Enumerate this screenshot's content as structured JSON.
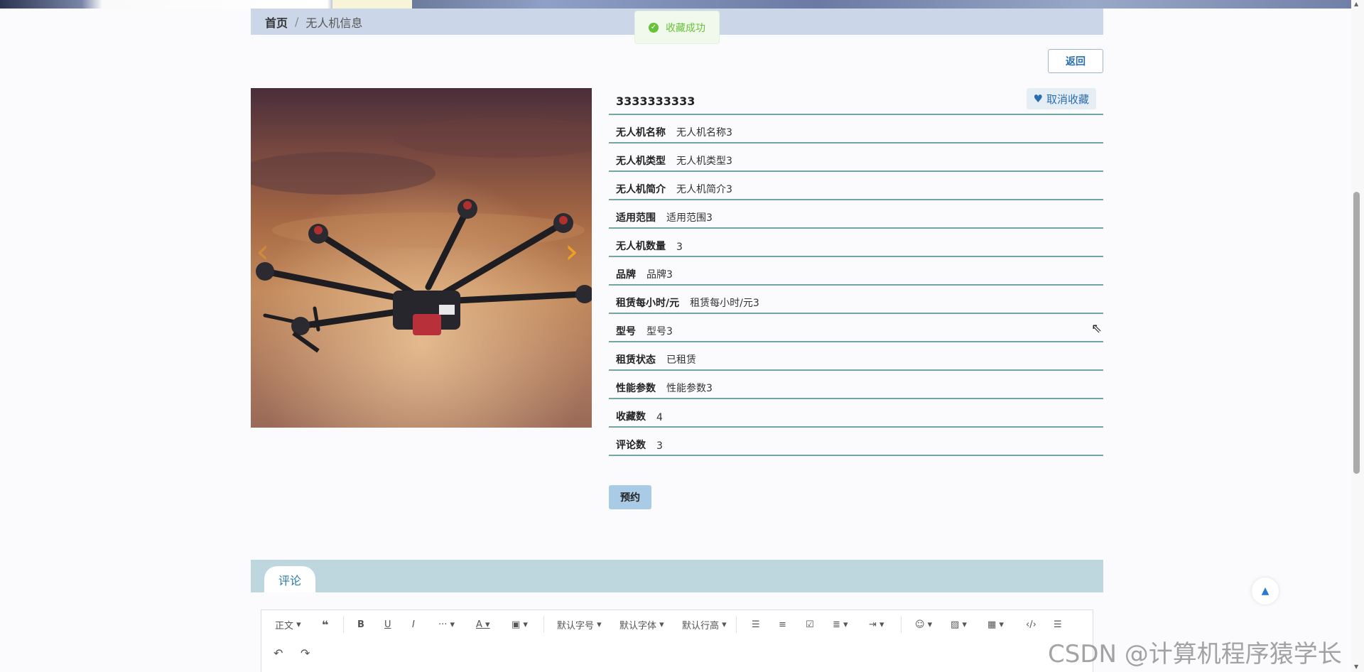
{
  "breadcrumb": {
    "home": "首页",
    "separator": "/",
    "current": "无人机信息"
  },
  "toast": {
    "message": "收藏成功",
    "icon": "check-circle-icon",
    "color": "#67c23a"
  },
  "back_button": "返回",
  "carousel": {
    "image": "hexacopter-drone-sunset-sky",
    "prev_icon": "chevron-left-icon",
    "next_icon": "chevron-right-icon"
  },
  "detail": {
    "title": "3333333333",
    "favorite_button": {
      "label": "取消收藏",
      "icon": "heart-icon"
    },
    "fields": [
      {
        "label": "无人机名称",
        "value": "无人机名称3"
      },
      {
        "label": "无人机类型",
        "value": "无人机类型3"
      },
      {
        "label": "无人机简介",
        "value": "无人机简介3"
      },
      {
        "label": "适用范围",
        "value": "适用范围3"
      },
      {
        "label": "无人机数量",
        "value": "3"
      },
      {
        "label": "品牌",
        "value": "品牌3"
      },
      {
        "label": "租赁每小时/元",
        "value": "租赁每小时/元3"
      },
      {
        "label": "型号",
        "value": "型号3"
      },
      {
        "label": "租赁状态",
        "value": "已租赁"
      },
      {
        "label": "性能参数",
        "value": "性能参数3"
      },
      {
        "label": "收藏数",
        "value": "4"
      },
      {
        "label": "评论数",
        "value": "3"
      }
    ]
  },
  "book_button": "预约",
  "comments": {
    "tab_label": "评论"
  },
  "editor_toolbar": {
    "paragraph": "正文",
    "font_size": "默认字号",
    "font_family": "默认字体",
    "line_height": "默认行高"
  },
  "watermark": "CSDN @计算机程序猿学长",
  "colors": {
    "accent": "#2a6db0",
    "divider": "#6fa6a0",
    "breadcrumb_bg": "#cbd7e8",
    "comments_bar": "#bed7de",
    "book_button": "#a9cbe6"
  }
}
